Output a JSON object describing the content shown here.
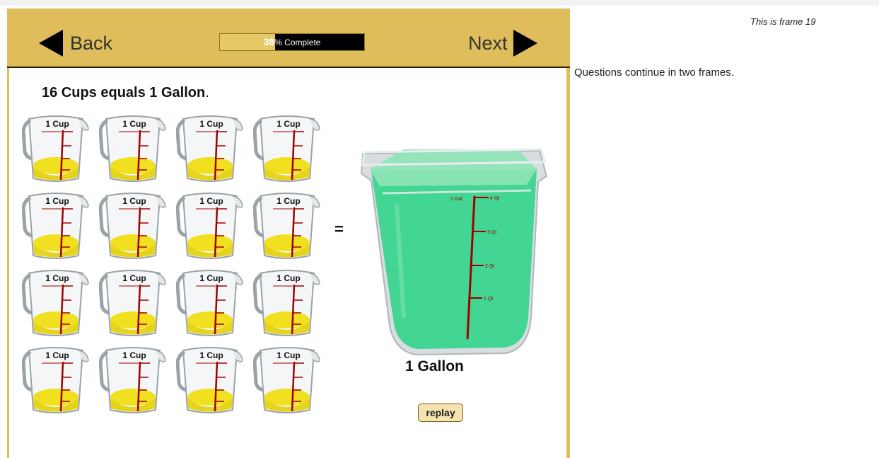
{
  "header": {
    "back_label": "Back",
    "next_label": "Next",
    "progress": {
      "percent": "38",
      "suffix": "% Complete",
      "fraction": 0.38
    }
  },
  "lesson": {
    "title_bold": "16 Cups equals 1 Gallon",
    "title_end": ".",
    "equals": "=",
    "cup_label": "1 Cup",
    "gallon_label": "1 Gallon",
    "replay_label": "replay",
    "bucket_marks": {
      "gal": "1 Gal",
      "q4": "4 Qt",
      "q3": "3 Qt",
      "q2": "2 Qt",
      "q1": "1 Qt"
    }
  },
  "side": {
    "frame_note": "This is frame 19",
    "questions_note": "Questions continue in two frames."
  },
  "colors": {
    "frame": "#dfbd5a",
    "liquid_cup": "#f0e020",
    "liquid_bucket": "#3ad48e",
    "scale": "#a00000"
  }
}
